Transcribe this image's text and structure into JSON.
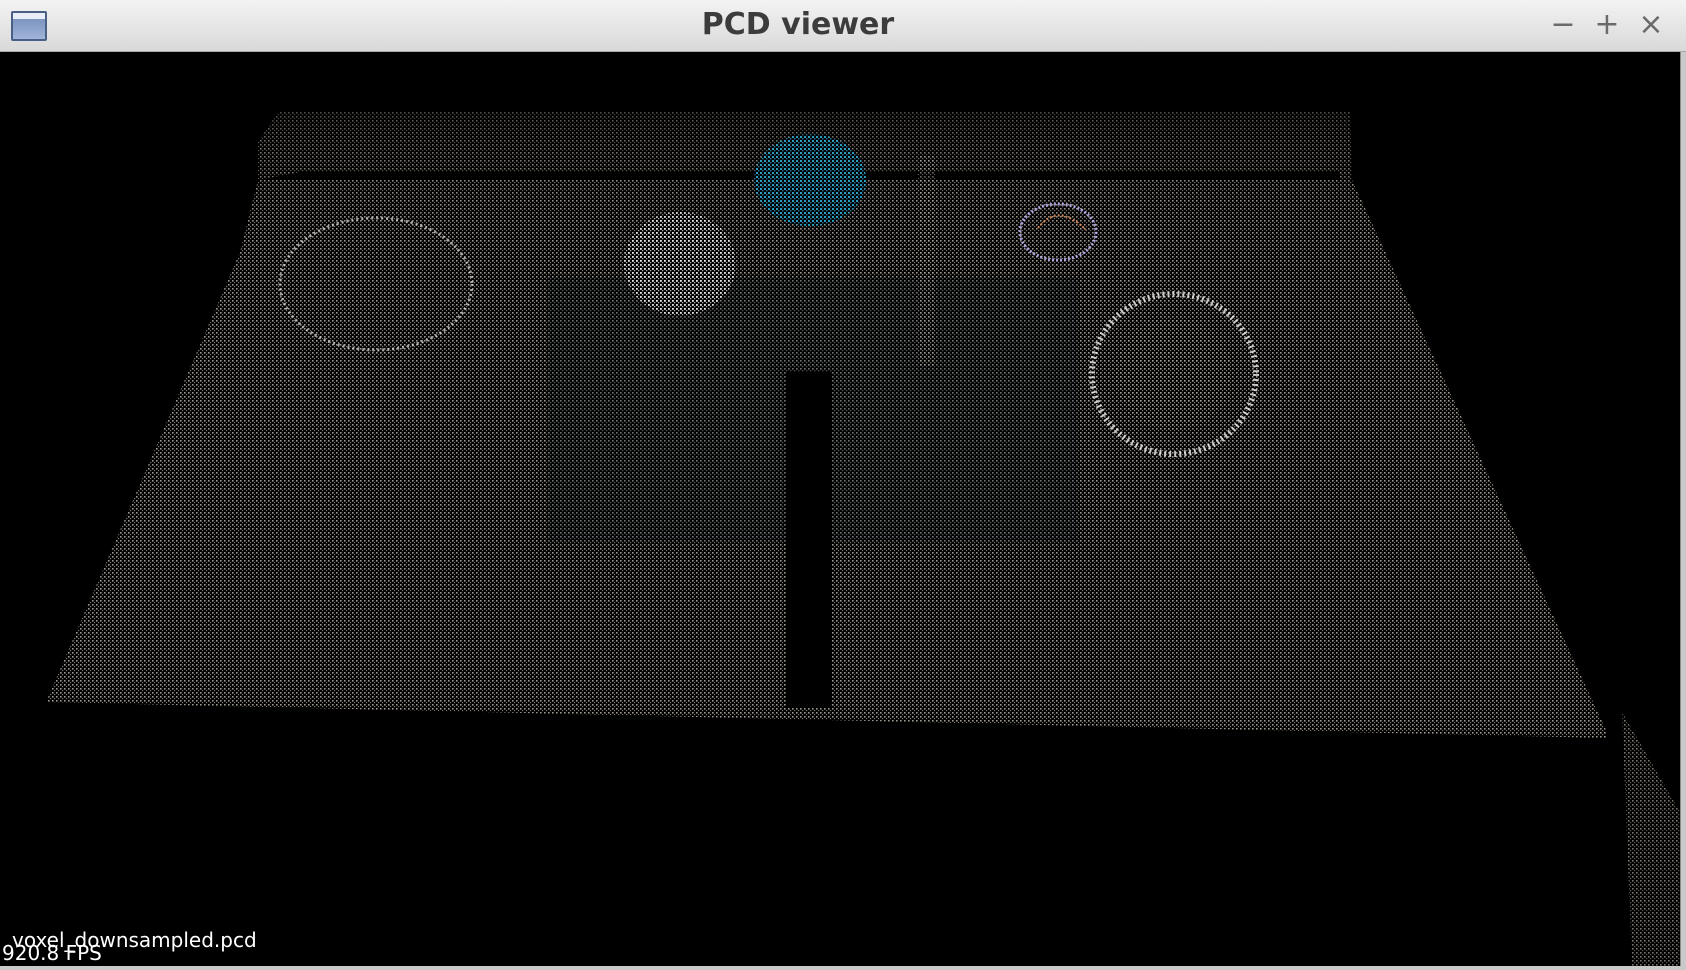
{
  "window": {
    "title": "PCD viewer",
    "icon": "window-icon",
    "controls": {
      "minimize": "−",
      "maximize": "+",
      "close": "×"
    }
  },
  "viewer": {
    "background": "#000000",
    "point_color_floor": "#bdb4a6",
    "point_color_sphere_blue": "#2a9ec2",
    "point_color_white": "#f2f2f2",
    "file_name": "voxel_downsampled.pcd",
    "fps": "920.8 FPS"
  }
}
